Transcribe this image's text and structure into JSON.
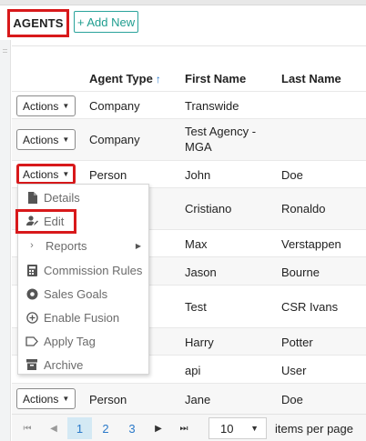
{
  "header": {
    "title": "AGENTS",
    "add_new": "+ Add New"
  },
  "table": {
    "columns": {
      "agent_type": "Agent Type",
      "sort_arrow": "↑",
      "first_name": "First Name",
      "last_name": "Last Name"
    },
    "actions_label": "Actions",
    "rows": [
      {
        "agent_type": "Company",
        "first_name": "Transwide",
        "last_name": ""
      },
      {
        "agent_type": "Company",
        "first_name": "Test Agency - MGA",
        "last_name": ""
      },
      {
        "agent_type": "Person",
        "first_name": "John",
        "last_name": "Doe"
      },
      {
        "agent_type": "",
        "first_name": "Cristiano",
        "last_name": "Ronaldo"
      },
      {
        "agent_type": "",
        "first_name": "Max",
        "last_name": "Verstappen"
      },
      {
        "agent_type": "",
        "first_name": "Jason",
        "last_name": "Bourne"
      },
      {
        "agent_type": "",
        "first_name": "Test",
        "last_name": "CSR Ivans"
      },
      {
        "agent_type": "",
        "first_name": "Harry",
        "last_name": "Potter"
      },
      {
        "agent_type": "",
        "first_name": "api",
        "last_name": "User"
      },
      {
        "agent_type": "Person",
        "first_name": "Jane",
        "last_name": "Doe"
      }
    ]
  },
  "menu": {
    "details": "Details",
    "edit": "Edit",
    "reports": "Reports",
    "commission_rules": "Commission Rules",
    "sales_goals": "Sales Goals",
    "enable_fusion": "Enable Fusion",
    "apply_tag": "Apply Tag",
    "archive": "Archive"
  },
  "pager": {
    "first": "⏮",
    "prev": "◀",
    "next": "▶",
    "last": "⏭",
    "pages": [
      "1",
      "2",
      "3"
    ],
    "current_page": "1",
    "per_page_value": "10",
    "per_page_label": "items per page"
  },
  "colors": {
    "accent": "#2a79c9",
    "highlight": "#d8191b",
    "brand_green": "#1f9d8f"
  }
}
